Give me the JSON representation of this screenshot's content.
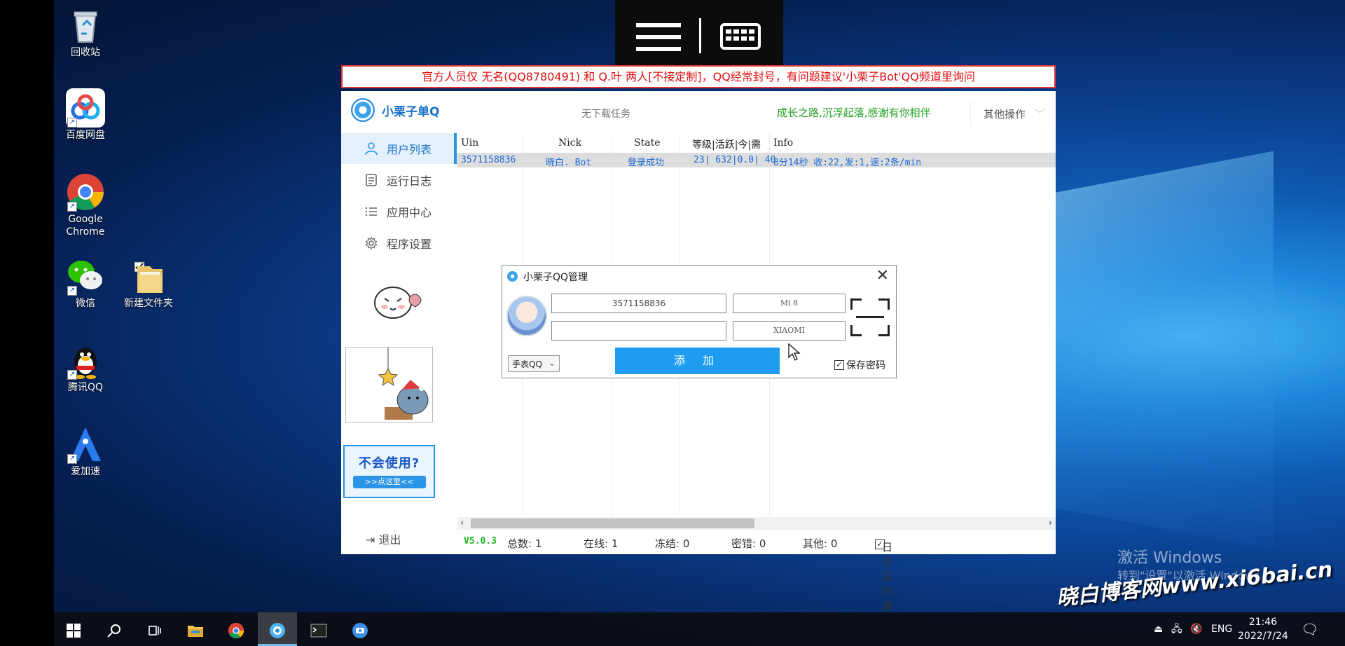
{
  "desktop": {
    "icons": [
      {
        "label": "回收站"
      },
      {
        "label": "百度网盘"
      },
      {
        "label": "Google Chrome"
      },
      {
        "label": "微信"
      },
      {
        "label": "新建文件夹"
      },
      {
        "label": "腾讯QQ"
      },
      {
        "label": "爱加速"
      }
    ],
    "activation_title": "激活 Windows",
    "activation_sub": "转到\"设置\"以激活 Windows。",
    "site_watermark": "晓白博客网www.xi6bai.cn"
  },
  "banner": "官方人员仅 无名(QQ8780491) 和 Q.叶 两人[不接定制]，QQ经常封号，有问题建议'小栗子Bot'QQ频道里询问",
  "app": {
    "name": "小栗子单Q",
    "task_status": "无下载任务",
    "slogan": "成长之路,沉浮起落,感谢有你相伴",
    "other_ops": "其他操作",
    "nav": [
      {
        "label": "用户列表",
        "icon": "user-icon",
        "active": true
      },
      {
        "label": "运行日志",
        "icon": "log-icon",
        "active": false
      },
      {
        "label": "应用中心",
        "icon": "list-icon",
        "active": false
      },
      {
        "label": "程序设置",
        "icon": "gear-icon",
        "active": false
      }
    ],
    "help_title": "不会使用?",
    "help_button": ">>点这里<<",
    "logout": "退出",
    "table": {
      "columns": [
        "Uin",
        "Nick",
        "State",
        "等级|活跃|今|需",
        "Info"
      ],
      "rows": [
        [
          "3571158836",
          "晓白. Bot",
          "登录成功",
          "23| 632|0.0| 40",
          "8分14秒 收:22,发:1,速:2条/min"
        ]
      ]
    },
    "status": {
      "version": "V5.0.3",
      "total": "总数: 1",
      "online": "在线: 1",
      "frozen": "冻结: 0",
      "pwd_error": "密错: 0",
      "other": "其他: 0",
      "log_scroll_label": "日志实时滚动",
      "log_scroll_checked": true
    }
  },
  "dialog": {
    "title": "小栗子QQ管理",
    "account_value": "3571158836",
    "password_value": "",
    "device_model": "Mi 8",
    "device_brand": "XIAOMI",
    "protocol": "手表QQ",
    "add_button": "添 加",
    "save_password_label": "保存密码",
    "save_password_checked": true
  },
  "taskbar": {
    "lang": "ENG",
    "time": "21:46",
    "date": "2022/7/24"
  }
}
